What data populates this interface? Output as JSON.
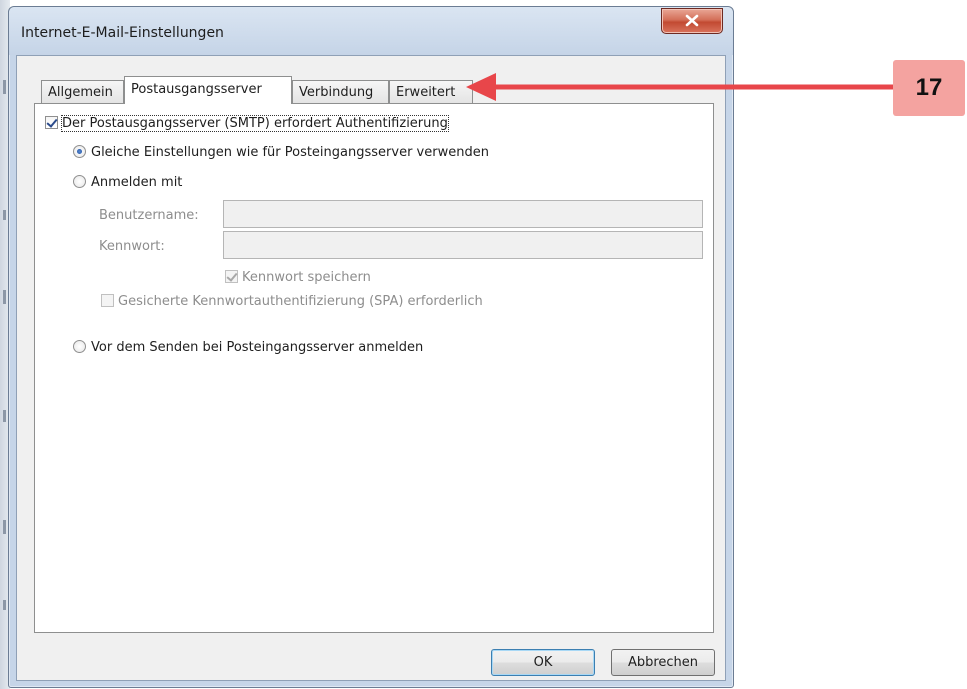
{
  "window": {
    "title": "Internet-E-Mail-Einstellungen"
  },
  "tabs": [
    {
      "label": "Allgemein"
    },
    {
      "label": "Postausgangsserver"
    },
    {
      "label": "Verbindung"
    },
    {
      "label": "Erweitert"
    }
  ],
  "outgoing": {
    "smtp_auth_label": "Der Postausgangsserver (SMTP) erfordert Authentifizierung",
    "same_settings_label": "Gleiche Einstellungen wie für Posteingangsserver verwenden",
    "login_with_label": "Anmelden mit",
    "username_label": "Benutzername:",
    "password_label": "Kennwort:",
    "save_password_label": "Kennwort speichern",
    "spa_label": "Gesicherte Kennwortauthentifizierung (SPA) erforderlich",
    "pop_before_smtp_label": "Vor dem Senden bei Posteingangsserver anmelden"
  },
  "buttons": {
    "ok": "OK",
    "cancel": "Abbrechen"
  },
  "annotation": {
    "number": "17"
  },
  "colors": {
    "annotation_arrow": "#e8464a",
    "annotation_badge": "#f4a3a0"
  }
}
